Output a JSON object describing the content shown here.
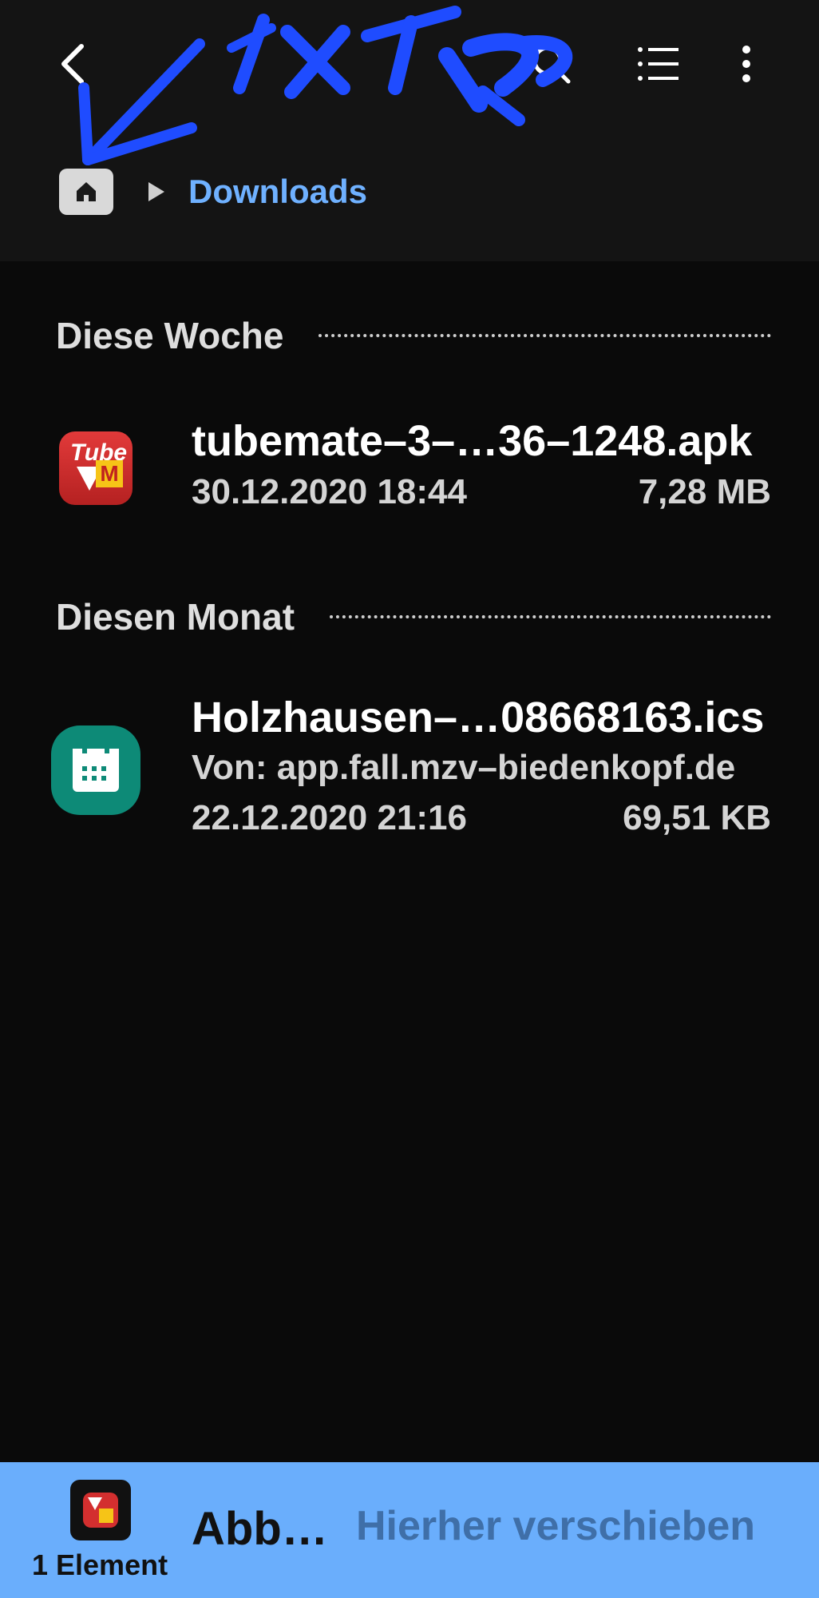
{
  "breadcrumb": {
    "current": "Downloads"
  },
  "sections": [
    {
      "title": "Diese Woche",
      "files": [
        {
          "name": "tubemate–3–…36–1248.apk",
          "date": "30.12.2020 18:44",
          "size": "7,28 MB",
          "icon": "tubemate-app-icon"
        }
      ]
    },
    {
      "title": "Diesen Monat",
      "files": [
        {
          "name": "Holzhausen–…08668163.ics",
          "source": "Von: app.fall.mzv–biedenkopf.de",
          "date": "22.12.2020 21:16",
          "size": "69,51 KB",
          "icon": "calendar-icon"
        }
      ]
    }
  ],
  "bottom_bar": {
    "selected_count": "1 Element",
    "cancel_label": "Abb…",
    "move_label": "Hierher verschieben"
  },
  "colors": {
    "accent": "#6fb1ff",
    "bottom_bar": "#6aaefc",
    "annotation": "#1f4cff",
    "calendar_icon": "#0d8a77"
  },
  "icons": {
    "back": "back-arrow-icon",
    "search": "search-icon",
    "list": "list-view-icon",
    "more": "more-vertical-icon",
    "home": "home-icon"
  }
}
